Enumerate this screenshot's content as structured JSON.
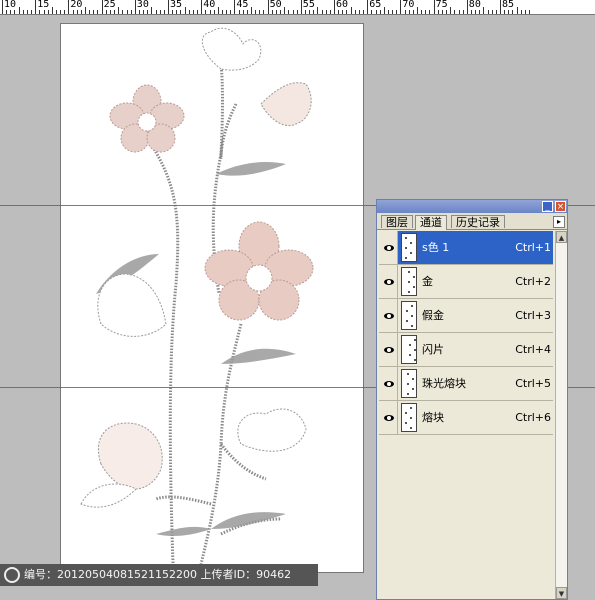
{
  "ruler": {
    "labels": [
      "10",
      "15",
      "20",
      "25",
      "30",
      "35",
      "40",
      "45",
      "50",
      "55",
      "60",
      "65",
      "70",
      "75",
      "80",
      "85"
    ]
  },
  "watermark": {
    "text": "编号：20120504081521152200 上传者ID：90462"
  },
  "panel": {
    "tabs": [
      "图层",
      "通道",
      "历史记录"
    ],
    "active_tab": "通道",
    "min_symbol": "_",
    "close_symbol": "×",
    "menu_symbol": "▸",
    "channels": [
      {
        "name": "s色 1",
        "shortcut": "Ctrl+1",
        "selected": true
      },
      {
        "name": "金",
        "shortcut": "Ctrl+2",
        "selected": false
      },
      {
        "name": "假金",
        "shortcut": "Ctrl+3",
        "selected": false
      },
      {
        "name": "闪片",
        "shortcut": "Ctrl+4",
        "selected": false
      },
      {
        "name": "珠光熔块",
        "shortcut": "Ctrl+5",
        "selected": false
      },
      {
        "name": "熔块",
        "shortcut": "Ctrl+6",
        "selected": false
      }
    ]
  },
  "colors": {
    "selection": "#2d63c7",
    "guide": "#4d5fb8",
    "petal": "#d9b8b0",
    "stem": "#8a8a8a"
  }
}
